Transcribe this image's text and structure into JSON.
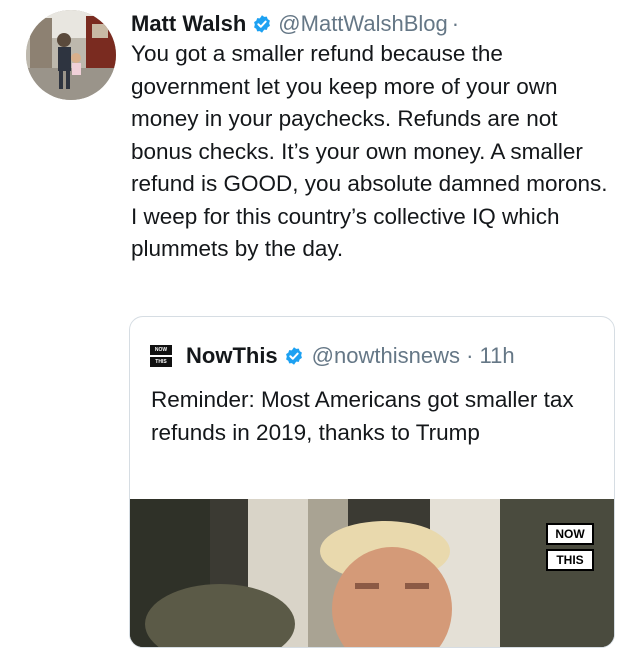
{
  "tweet": {
    "author_name": "Matt Walsh",
    "handle": "@MattWalshBlog",
    "separator": "·",
    "text": "You got a smaller refund because the government let you keep more of your own money in your paychecks. Refunds are not bonus checks. It’s your own money. A smaller refund is GOOD, you absolute damned morons. I weep for this country’s collective IQ which plummets by the day."
  },
  "quoted_tweet": {
    "author_name": "NowThis",
    "handle": "@nowthisnews · 11h",
    "text": "Reminder: Most Americans got smaller tax refunds in 2019, thanks to Trump",
    "logo_line1": "NOW",
    "logo_line2": "THIS"
  },
  "media_badge": {
    "line1": "NOW",
    "line2": "THIS"
  },
  "colors": {
    "verified": "#1da1f2",
    "text": "#14171a",
    "secondary": "#657786",
    "border": "#d6dde3"
  },
  "icons": {
    "verified": "verified-badge-icon"
  }
}
